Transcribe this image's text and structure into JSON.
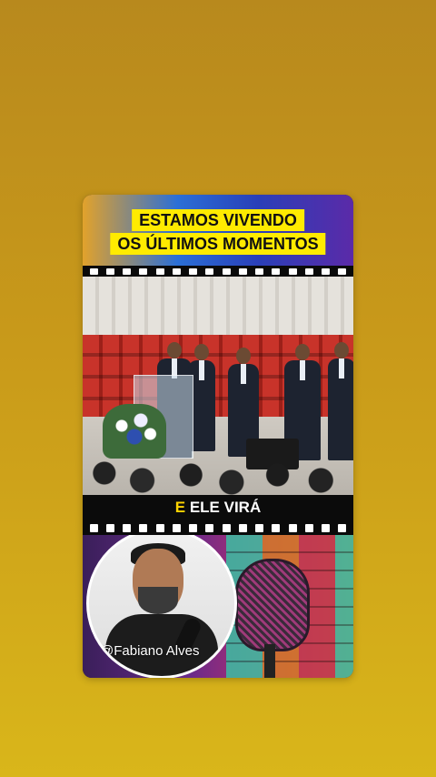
{
  "video": {
    "title_line1": "ESTAMOS VIVENDO",
    "title_line2": "OS ÚLTIMOS MOMENTOS",
    "caption_emphasis": "E",
    "caption_rest": " ELE VIRÁ",
    "creator_handle": "@Fabiano Alves"
  },
  "colors": {
    "background_top": "#b8891d",
    "background_bottom": "#d9b61a",
    "title_highlight": "#ffeb00",
    "caption_emphasis": "#ffd400"
  }
}
